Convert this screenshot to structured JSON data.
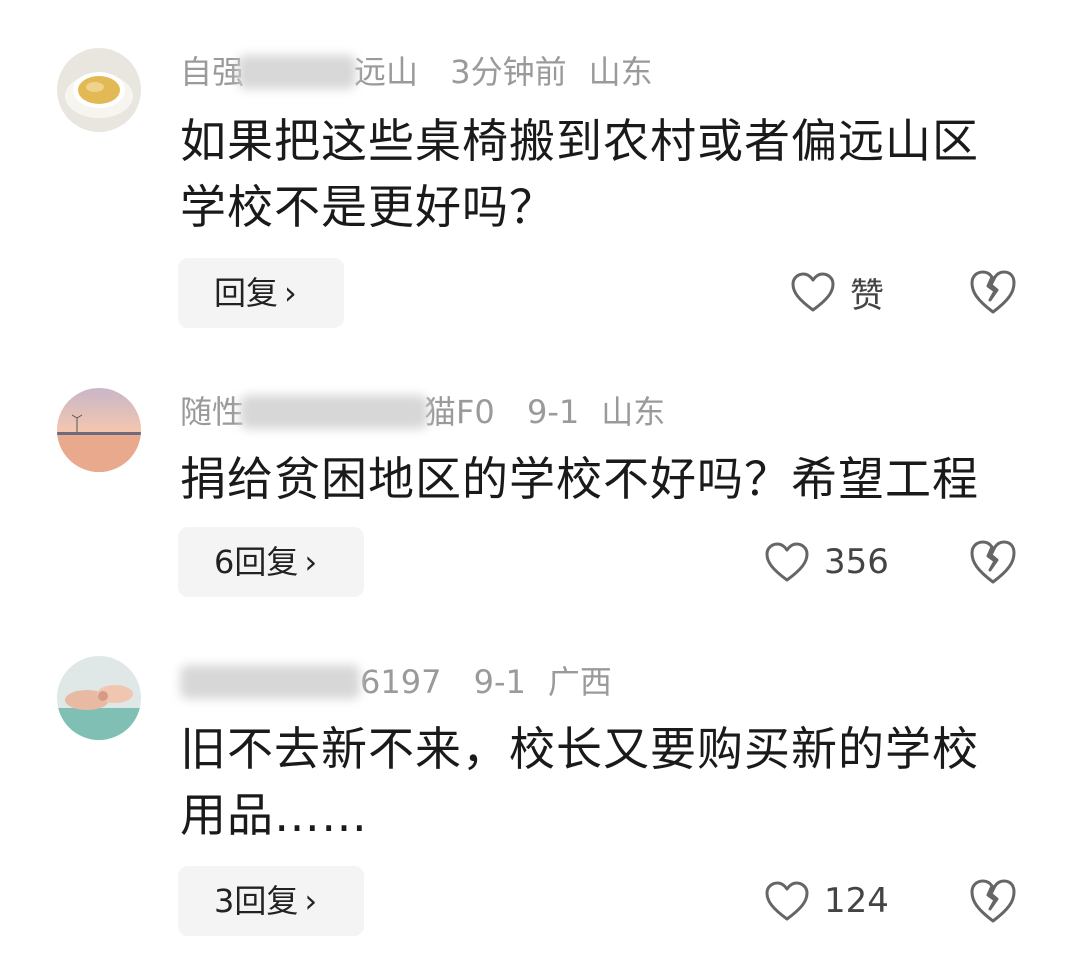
{
  "comments": [
    {
      "username_partial": "自强",
      "username_tail": "远山",
      "time": "3分钟前",
      "location": "山东",
      "text": "如果把这些桌椅搬到农村或者偏远山区学校不是更好吗？",
      "reply_label": "回复",
      "like_label": "赞",
      "avatar": "tea-cup-avatar"
    },
    {
      "username_partial": "随性",
      "username_tail": "猫F0",
      "time": "9-1",
      "location": "山东",
      "text": "捐给贫困地区的学校不好吗？希望工程",
      "reply_label": "6回复",
      "like_label": "356",
      "avatar": "sunset-sea-avatar"
    },
    {
      "username_partial": "",
      "username_tail": "6197",
      "time": "9-1",
      "location": "广西",
      "text": "旧不去新不来，校长又要购买新的学校用品……",
      "reply_label": "3回复",
      "like_label": "124",
      "avatar": "hands-avatar"
    }
  ],
  "icons": {
    "chevron": "›",
    "like": "heart-outline-icon",
    "dislike": "broken-heart-icon"
  },
  "colors": {
    "meta": "#9a9a9a",
    "text": "#1a1a1a",
    "button_bg": "#f4f4f4"
  }
}
